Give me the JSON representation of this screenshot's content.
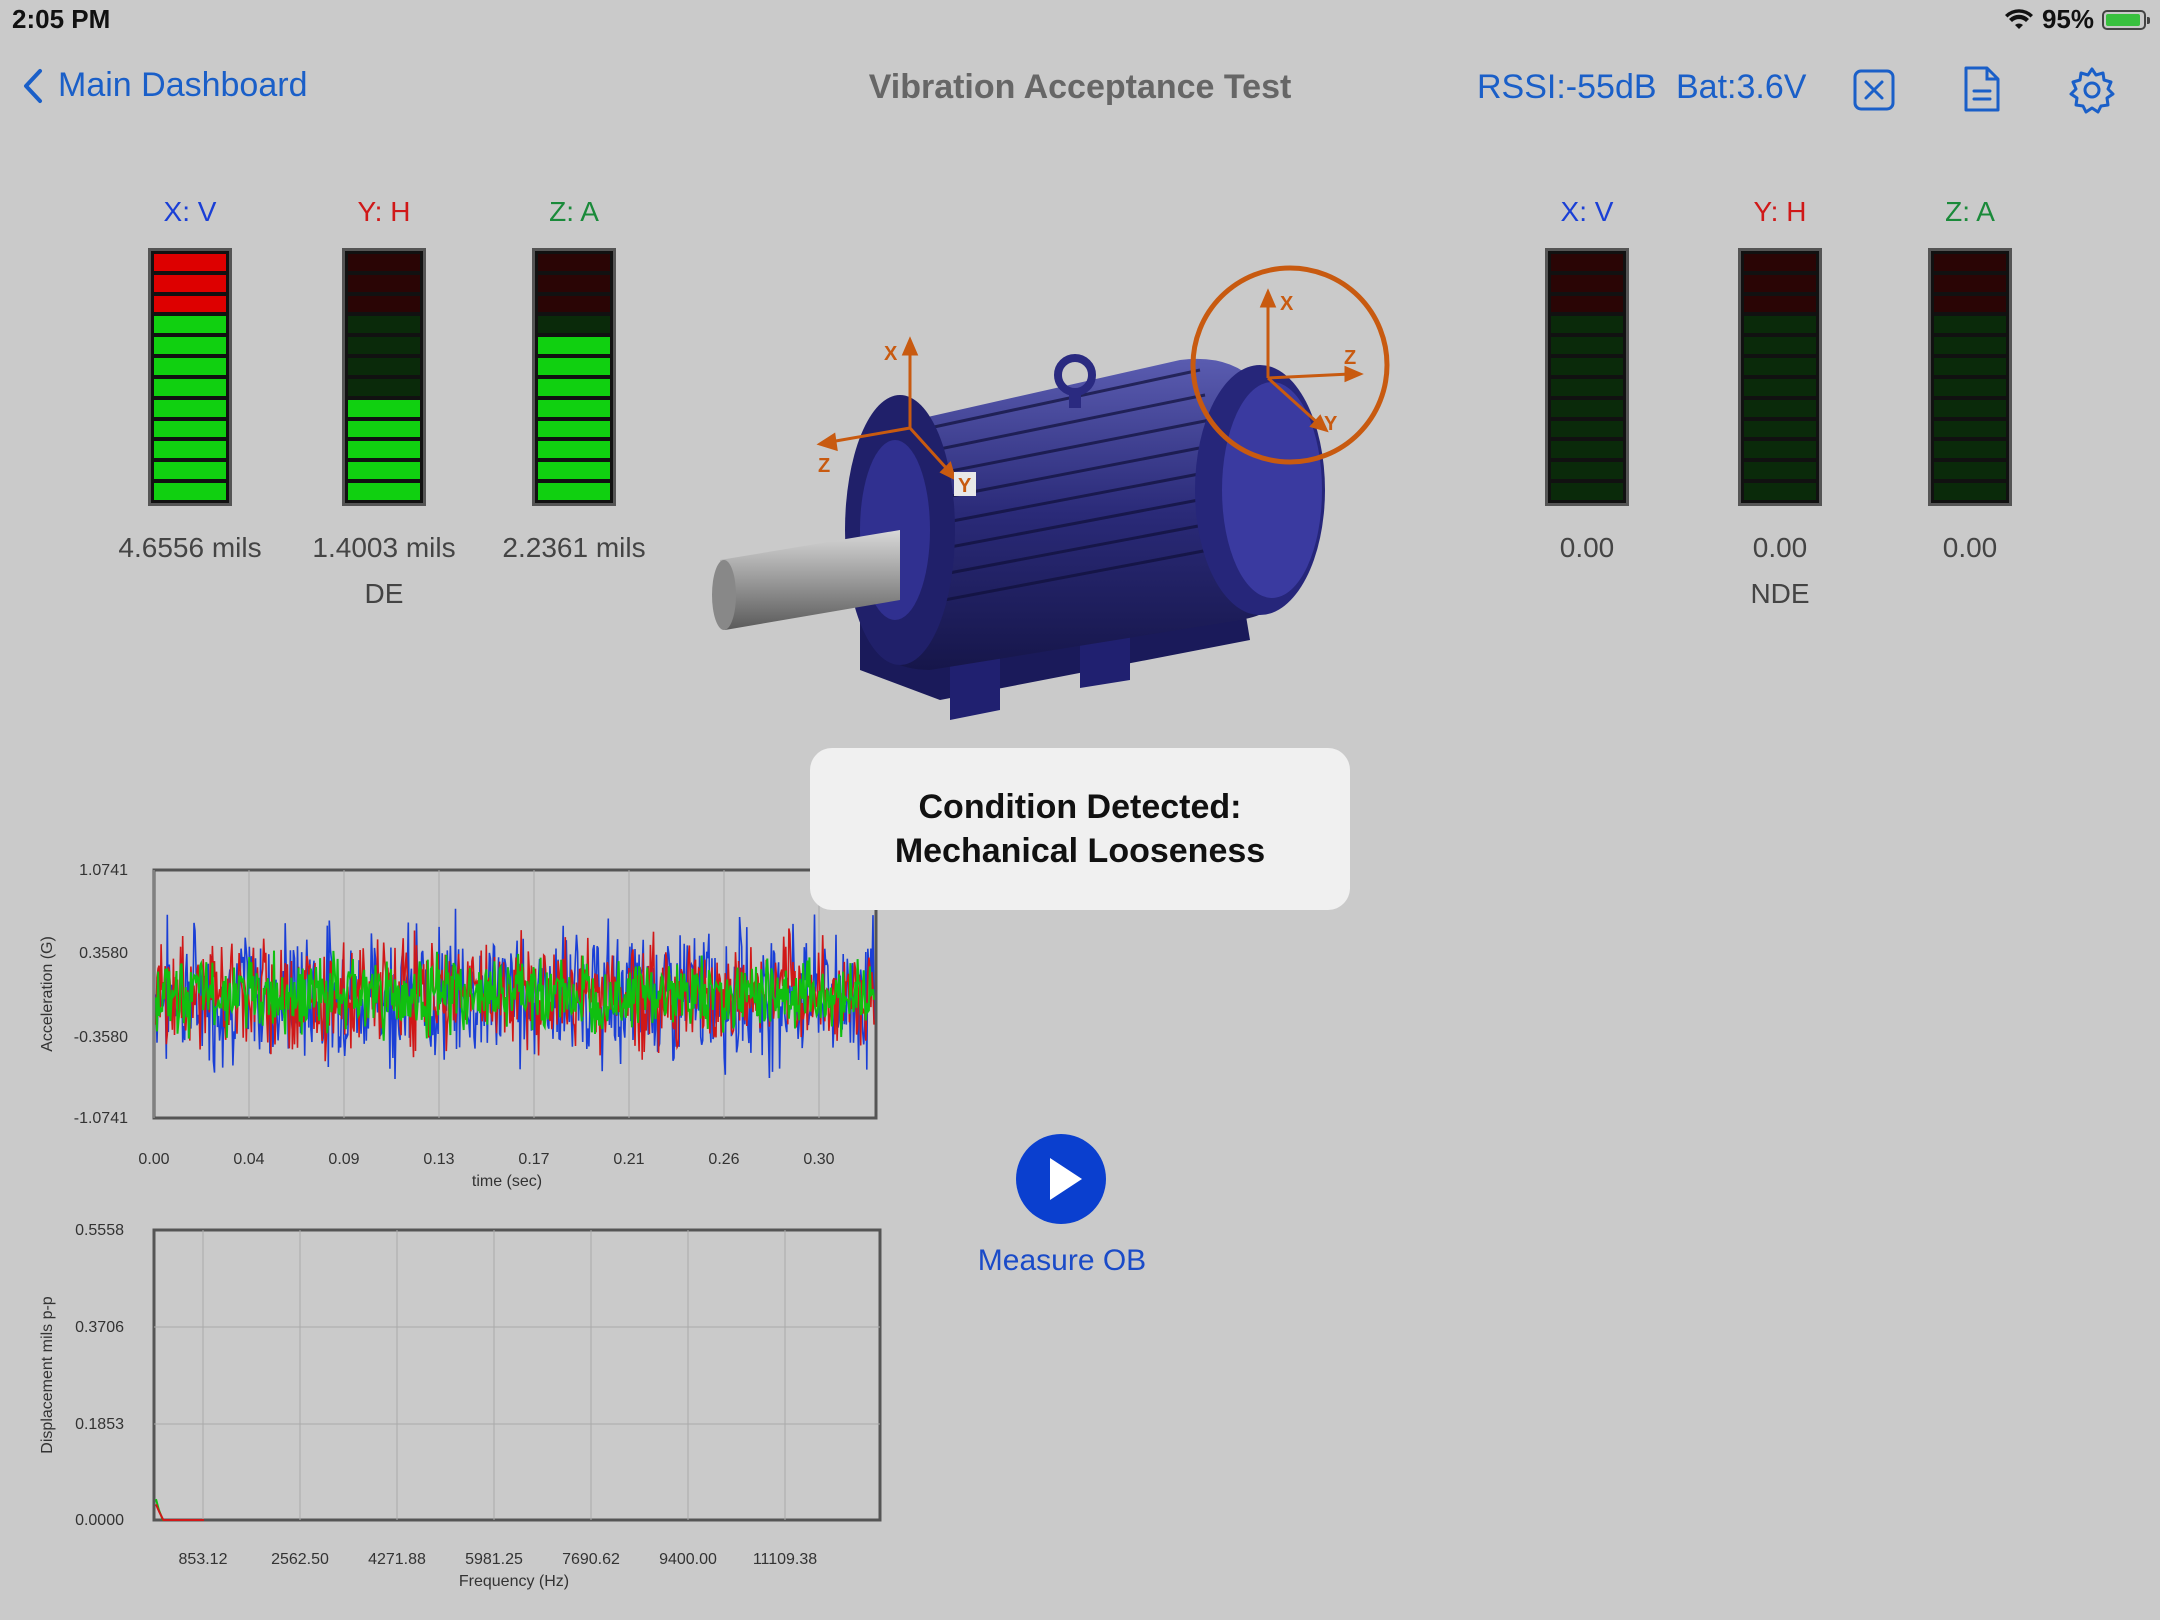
{
  "status_bar": {
    "time": "2:05 PM",
    "battery_percent": "95%",
    "battery_level": 0.95,
    "icons": [
      "wifi-icon",
      "battery-charging-icon"
    ]
  },
  "nav": {
    "back_label": "Main Dashboard",
    "title": "Vibration Acceptance Test",
    "rssi": "RSSI:-55dB",
    "battery": "Bat:3.6V",
    "icons": [
      "close-box-icon",
      "report-document-icon",
      "settings-gear-icon"
    ]
  },
  "colors": {
    "accent": "#1a5fc8",
    "x_axis": "#1a3fd6",
    "y_axis": "#d01818",
    "z_axis": "#1a8a3a",
    "bar_green": "#10d010",
    "bar_red": "#dd0000",
    "bar_dark_green": "#0a2a0a",
    "bar_dark_red": "#2a0505",
    "orange": "#c85a10",
    "play": "#0a3fcf"
  },
  "de": {
    "label": "DE",
    "meters": [
      {
        "axis": "X: V",
        "value": "4.6556 mils",
        "lit_green": 9,
        "lit_red": 3
      },
      {
        "axis": "Y: H",
        "value": "1.4003 mils",
        "lit_green": 5,
        "lit_red": 0
      },
      {
        "axis": "Z: A",
        "value": "2.2361 mils",
        "lit_green": 8,
        "lit_red": 0
      }
    ]
  },
  "nde": {
    "label": "NDE",
    "meters": [
      {
        "axis": "X: V",
        "value": "0.00",
        "lit_green": 0,
        "lit_red": 0
      },
      {
        "axis": "Y: H",
        "value": "0.00",
        "lit_green": 0,
        "lit_red": 0
      },
      {
        "axis": "Z: A",
        "value": "0.00",
        "lit_green": 0,
        "lit_red": 0
      }
    ]
  },
  "motor_axes": {
    "left": [
      "X",
      "Z",
      "Y"
    ],
    "right": [
      "X",
      "Z",
      "Y"
    ]
  },
  "condition": {
    "line1": "Condition Detected:",
    "line2": "Mechanical Looseness"
  },
  "action": {
    "label": "Measure OB"
  },
  "chart_data": [
    {
      "type": "line",
      "ylabel": "Acceleration (G)",
      "xlabel": "time (sec)",
      "y_ticks": [
        "1.0741",
        "0.3580",
        "-0.3580",
        "-1.0741"
      ],
      "x_ticks": [
        "0.00",
        "0.04",
        "0.09",
        "0.13",
        "0.17",
        "0.21",
        "0.26",
        "0.30"
      ],
      "ylim": [
        -1.0741,
        1.0741
      ],
      "xlim": [
        0,
        0.3
      ],
      "grid": true,
      "series": [
        {
          "color": "#1a3fd6",
          "amplitude": 0.78
        },
        {
          "color": "#d01818",
          "amplitude": 0.62
        },
        {
          "color": "#10c010",
          "amplitude": 0.42
        }
      ]
    },
    {
      "type": "line",
      "ylabel": "Displacement mils p-p",
      "xlabel": "Frequency (Hz)",
      "y_ticks": [
        "0.5558",
        "0.3706",
        "0.1853",
        "0.0000"
      ],
      "x_ticks": [
        "853.12",
        "2562.50",
        "4271.88",
        "5981.25",
        "7690.62",
        "9400.00",
        "11109.38"
      ],
      "ylim": [
        0,
        0.5558
      ],
      "grid": true,
      "series": [
        {
          "color": "#10c010",
          "x": [
            0,
            50,
            120,
            300,
            853.12
          ],
          "y": [
            0.04,
            0.02,
            0.0,
            0.0,
            0.0
          ]
        },
        {
          "color": "#d01818",
          "x": [
            0,
            60,
            130,
            853.12
          ],
          "y": [
            0.03,
            0.015,
            0.0,
            0.0
          ]
        }
      ]
    }
  ]
}
